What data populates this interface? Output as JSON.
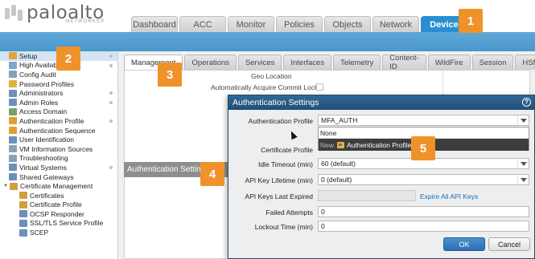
{
  "brand": {
    "name": "paloalto",
    "sub": "NETWORKS®"
  },
  "topnav": [
    "Dashboard",
    "ACC",
    "Monitor",
    "Policies",
    "Objects",
    "Network",
    "Device"
  ],
  "sidebar": [
    {
      "label": "Setup",
      "color": "#e6a23c",
      "dot": true,
      "selected": true
    },
    {
      "label": "High Availability",
      "color": "#7aa6d6",
      "dot": true
    },
    {
      "label": "Config Audit",
      "color": "#8aa0b8"
    },
    {
      "label": "Password Profiles",
      "color": "#e0b040"
    },
    {
      "label": "Administrators",
      "color": "#6f8fb8",
      "dot": true
    },
    {
      "label": "Admin Roles",
      "color": "#6f8fb8",
      "dot": true
    },
    {
      "label": "Access Domain",
      "color": "#7aa06a"
    },
    {
      "label": "Authentication Profile",
      "color": "#e0a030",
      "dot": true
    },
    {
      "label": "Authentication Sequence",
      "color": "#e0a030"
    },
    {
      "label": "User Identification",
      "color": "#6f8fb8"
    },
    {
      "label": "VM Information Sources",
      "color": "#8aa0b8"
    },
    {
      "label": "Troubleshooting",
      "color": "#8aa0b8"
    },
    {
      "label": "Virtual Systems",
      "color": "#6f8fb8",
      "dot": true
    },
    {
      "label": "Shared Gateways",
      "color": "#6f8fb8"
    },
    {
      "label": "Certificate Management",
      "color": "#d0a040",
      "expand": true
    },
    {
      "label": "Certificates",
      "color": "#d0a040",
      "indent": true
    },
    {
      "label": "Certificate Profile",
      "color": "#d0a040",
      "indent": true
    },
    {
      "label": "OCSP Responder",
      "color": "#6f8fb8",
      "indent": true
    },
    {
      "label": "SSL/TLS Service Profile",
      "color": "#6f8fb8",
      "indent": true
    },
    {
      "label": "SCEP",
      "color": "#6f8fb8",
      "indent": true
    }
  ],
  "subtabs": [
    "Management",
    "Operations",
    "Services",
    "Interfaces",
    "Telemetry",
    "Content-ID",
    "WildFire",
    "Session",
    "HSM"
  ],
  "panel": {
    "geo_location": "Geo Location",
    "acquire_lock": "Automatically Acquire Commit Lock",
    "auth_settings_header": "Authentication Settings"
  },
  "dialog": {
    "title": "Authentication Settings",
    "auth_profile_label": "Authentication Profile",
    "auth_profile_value": "MFA_AUTH",
    "dropdown_none": "None",
    "dropdown_new_prefix": "New",
    "dropdown_new_item": "Authentication Profile",
    "certificate_profile_label": "Certificate Profile",
    "idle_timeout_label": "Idle Timeout (min)",
    "idle_timeout_value": "60 (default)",
    "api_key_lifetime_label": "API Key Lifetime (min)",
    "api_key_lifetime_value": "0 (default)",
    "api_keys_last_expired_label": "API Keys Last Expired",
    "expire_all_link": "Expire All API Keys",
    "failed_attempts_label": "Failed Attempts",
    "failed_attempts_value": "0",
    "lockout_time_label": "Lockout Time (min)",
    "lockout_time_value": "0",
    "ok": "OK",
    "cancel": "Cancel"
  },
  "callouts": [
    "1",
    "2",
    "3",
    "4",
    "5"
  ],
  "colors": {
    "accent": "#2a8fd0",
    "callout": "#f0922a",
    "dialog_title": "#2f6896"
  }
}
